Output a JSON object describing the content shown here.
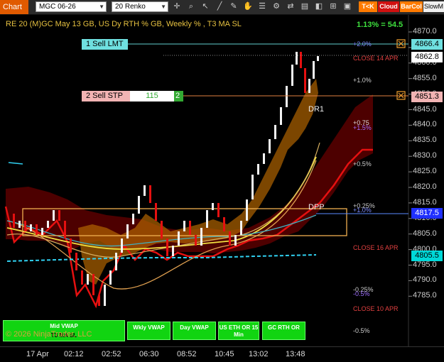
{
  "toolbar": {
    "chart_tab": "Chart",
    "instrument": "MGC 06-26",
    "bar_type": "20 Renko",
    "tk_label": "T<K",
    "cloud_label": "Cloud",
    "barcol_label": "BarCol",
    "slowm_label": "SlowM"
  },
  "chart": {
    "header": "RE 20  (M)GC May 13 GB, US Dy RTH % GB, Weekly % , T3 MA SL",
    "pct_readout": "1.13% = 54.5",
    "copyright": "© 2026 NinjaTrader, LLC",
    "price_labels": [
      "4870.0",
      "4865.0",
      "4860.0",
      "4855.0",
      "4850.0",
      "4845.0",
      "4840.0",
      "4835.0",
      "4830.0",
      "4825.0",
      "4820.0",
      "4815.0",
      "4810.0",
      "4805.0",
      "4800.0",
      "4795.0",
      "4790.0",
      "4785.0"
    ],
    "price_boxes": {
      "sell_lmt": "4866.4",
      "last": "4862.8",
      "sell_stp": "4851.3",
      "blue": "4817.5",
      "cyan": "4805.5"
    },
    "orders": {
      "sell_lmt_label": "1 Sell LMT",
      "sell_stp_label": "2 Sell STP",
      "stp_qty": "115",
      "stp_count": "2"
    },
    "annotations": {
      "p2": "+2.0%",
      "close14": "CLOSE 14 APR",
      "p1": "+1.0%",
      "dr1": "DR1",
      "p075": "+0.75",
      "p15": "+1.5%",
      "p05": "+0.5%",
      "p025": "+0.25%",
      "dpp": "DPP",
      "p1b": "+1.0%",
      "close16": "CLOSE 16 APR",
      "m025": "-0.25%",
      "m05a": "-0.5%",
      "close10": "CLOSE 10 APR",
      "m05": "-0.5%"
    },
    "time_labels": [
      "17 Apr",
      "02:12",
      "02:52",
      "06:30",
      "08:52",
      "10:45",
      "13:02",
      "13:48"
    ]
  },
  "buttons": {
    "mid_vwap": "Mid VWAP",
    "t3": "T3 MA SL",
    "wkly_vwap": "Wkly VWAP",
    "day_vwap": "Day VWAP",
    "us_eth": "US ETH OR 15 Min",
    "gc_rth": "GC RTH OR"
  }
}
